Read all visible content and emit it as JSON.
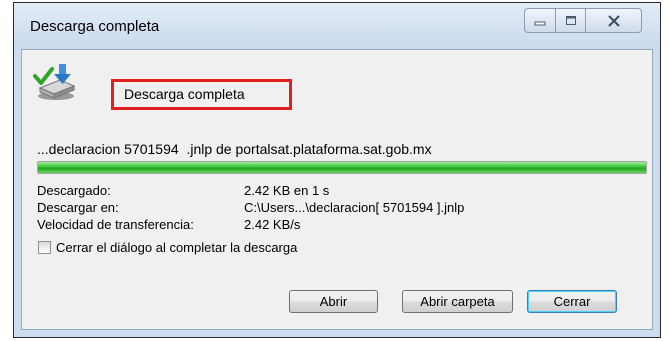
{
  "window": {
    "title": "Descarga completa"
  },
  "headline": "Descarga completa",
  "file_line": "...declaracion 5701594  .jnlp de portalsat.plataforma.sat.gob.mx",
  "progress": 1.0,
  "details": [
    {
      "label": "Descargado:",
      "value": "2.42 KB en 1 s"
    },
    {
      "label": "Descargar en:",
      "value": "C:\\Users...\\declaracion[ 5701594 ].jnlp"
    },
    {
      "label": "Velocidad de transferencia:",
      "value": "2.42 KB/s"
    }
  ],
  "close_checkbox": {
    "label": "Cerrar el diálogo al completar la descarga",
    "checked": false
  },
  "buttons": {
    "open": "Abrir",
    "open_folder": "Abrir carpeta",
    "close": "Cerrar"
  },
  "colors": {
    "highlight_border": "#e21f1f",
    "progress_fill": "#22a520"
  },
  "icons": [
    "download-complete-icon",
    "minimize-icon",
    "maximize-icon",
    "close-icon"
  ]
}
